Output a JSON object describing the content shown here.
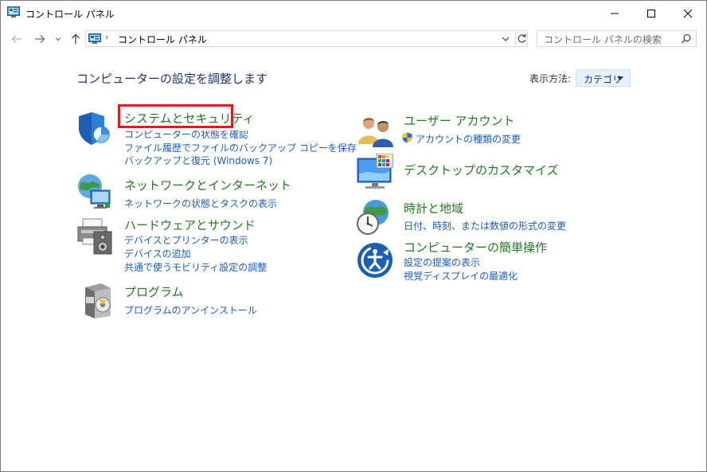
{
  "window": {
    "title": "コントロール パネル"
  },
  "address": {
    "path": "コントロール パネル",
    "separator": "›"
  },
  "search": {
    "placeholder": "コントロール パネルの検索"
  },
  "main": {
    "title": "コンピューターの設定を調整します",
    "view_by_label": "表示方法:",
    "view_by_value": "カテゴリ"
  },
  "categories": {
    "system": {
      "title": "システムとセキュリティ",
      "links": [
        "コンピューターの状態を確認",
        "ファイル履歴でファイルのバックアップ コピーを保存",
        "バックアップと復元 (Windows 7)"
      ]
    },
    "network": {
      "title": "ネットワークとインターネット",
      "links": [
        "ネットワークの状態とタスクの表示"
      ]
    },
    "hardware": {
      "title": "ハードウェアとサウンド",
      "links": [
        "デバイスとプリンターの表示",
        "デバイスの追加",
        "共通で使うモビリティ設定の調整"
      ]
    },
    "programs": {
      "title": "プログラム",
      "links": [
        "プログラムのアンインストール"
      ]
    },
    "users": {
      "title": "ユーザー アカウント",
      "links": [
        "アカウントの種類の変更"
      ]
    },
    "appearance": {
      "title": "デスクトップのカスタマイズ",
      "links": []
    },
    "clock": {
      "title": "時計と地域",
      "links": [
        "日付、時刻、または数値の形式の変更"
      ]
    },
    "access": {
      "title": "コンピューターの簡単操作",
      "links": [
        "設定の提案の表示",
        "視覚ディスプレイの最適化"
      ]
    }
  },
  "colors": {
    "title_blue": "#1e3287",
    "category_green": "#1e7a1e",
    "link_blue": "#1a5cc8",
    "highlight_red": "#e3191d"
  }
}
